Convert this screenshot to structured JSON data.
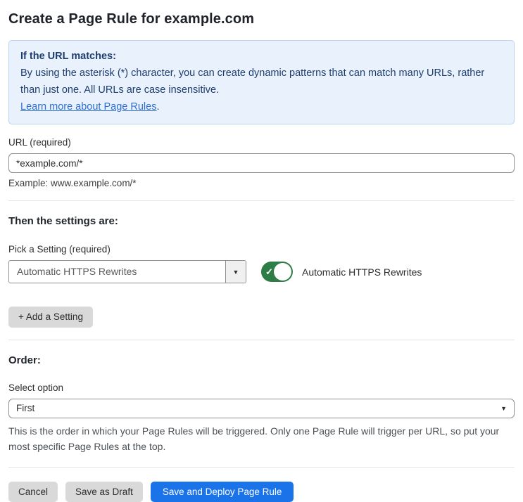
{
  "page": {
    "title": "Create a Page Rule for example.com"
  },
  "info_box": {
    "heading": "If the URL matches:",
    "body": "By using the asterisk (*) character, you can create dynamic patterns that can match many URLs, rather than just one. All URLs are case insensitive.",
    "link_label": "Learn more about Page Rules",
    "link_suffix": "."
  },
  "url_field": {
    "label": "URL (required)",
    "value": "*example.com/*",
    "example": "Example: www.example.com/*"
  },
  "settings": {
    "heading": "Then the settings are:",
    "pick_label": "Pick a Setting (required)",
    "selected_setting": "Automatic HTTPS Rewrites",
    "toggle_label": "Automatic HTTPS Rewrites",
    "toggle_state": "on",
    "add_button_label": "+ Add a Setting"
  },
  "order": {
    "heading": "Order:",
    "select_label": "Select option",
    "selected_option": "First",
    "help": "This is the order in which your Page Rules will be triggered. Only one Page Rule will trigger per URL, so put your most specific Page Rules at the top."
  },
  "footer": {
    "cancel_label": "Cancel",
    "save_draft_label": "Save as Draft",
    "save_deploy_label": "Save and Deploy Page Rule"
  },
  "icons": {
    "caret_down": "▼",
    "check": "✓"
  },
  "colors": {
    "info_bg": "#e9f2fc",
    "info_border": "#b9d4f1",
    "info_text": "#1d3d6f",
    "link_blue": "#2f6fd1",
    "toggle_green": "#2e7d46",
    "primary_blue": "#1a73e8",
    "button_gray": "#d9d9d9"
  }
}
